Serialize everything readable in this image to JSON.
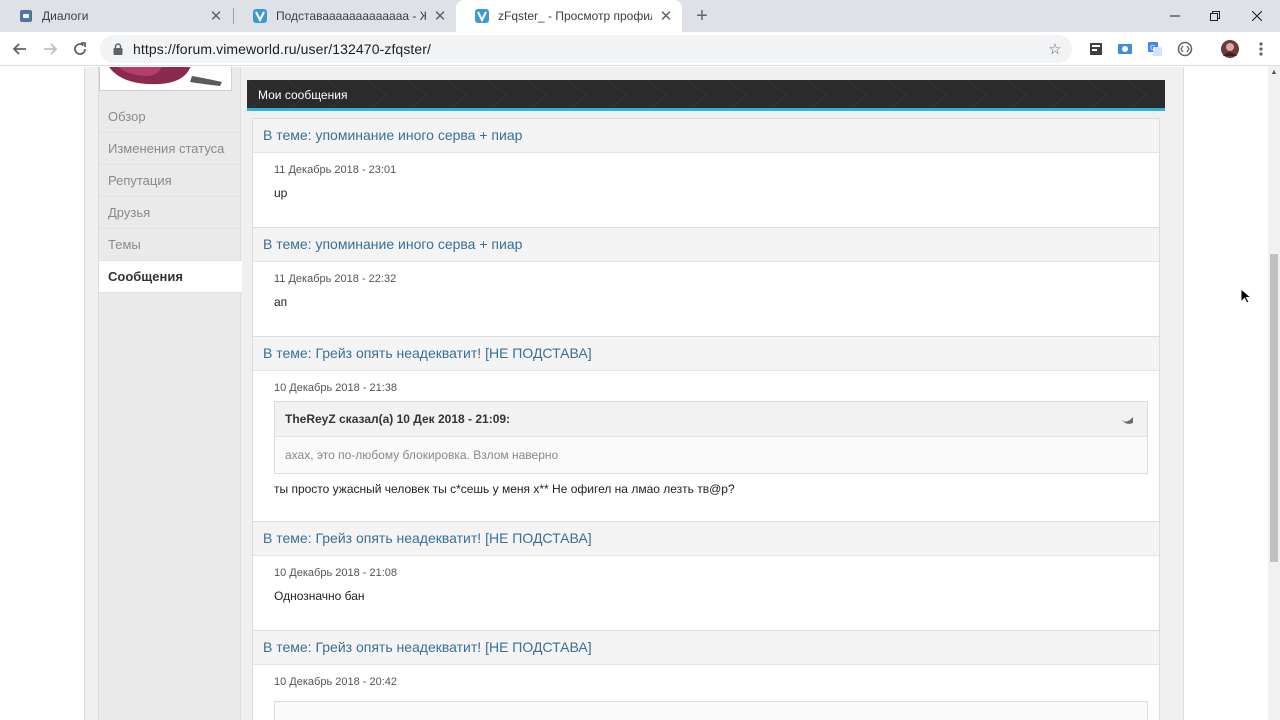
{
  "browser": {
    "tabs": [
      {
        "title": "Диалоги",
        "favicon": "chat-icon",
        "active": false
      },
      {
        "title": "Подставааааааааааааа - Жалобы",
        "favicon": "vimeworld-icon",
        "active": false
      },
      {
        "title": "zFqster_ - Просмотр профиля - ",
        "favicon": "vimeworld-icon",
        "active": true
      }
    ],
    "url": "https://forum.vimeworld.ru/user/132470-zfqster/"
  },
  "sidebar": {
    "items": [
      {
        "label": "Обзор",
        "active": false
      },
      {
        "label": "Изменения статуса",
        "active": false
      },
      {
        "label": "Репутация",
        "active": false
      },
      {
        "label": "Друзья",
        "active": false
      },
      {
        "label": "Темы",
        "active": false
      },
      {
        "label": "Сообщения",
        "active": true
      }
    ]
  },
  "panel": {
    "title": "Мои сообщения"
  },
  "posts": [
    {
      "title": "В теме: упоминание иного серва + пиар",
      "date": "11 Декабрь 2018 - 23:01",
      "text": "up"
    },
    {
      "title": "В теме: упоминание иного серва + пиар",
      "date": "11 Декабрь 2018 - 22:32",
      "text": "ап"
    },
    {
      "title": "В теме: Грейз опять неадекватит! [НЕ ПОДСТАВА]",
      "date": "10 Декабрь 2018 - 21:38",
      "quote": {
        "head": "TheReyZ сказал(а) 10 Дек 2018 - 21:09:",
        "text": "ахах, это по-любому блокировка. Взлом наверно"
      },
      "text": "ты просто ужасный человек ты с*сешь у меня х**  Не офигел на лмао лезть тв@р?"
    },
    {
      "title": "В теме: Грейз опять неадекватит! [НЕ ПОДСТАВА]",
      "date": "10 Декабрь 2018 - 21:08",
      "text": "Однозначно бан"
    },
    {
      "title": "В теме: Грейз опять неадекватит! [НЕ ПОДСТАВА]",
      "date": "10 Декабрь 2018 - 20:42",
      "text": ""
    }
  ],
  "colors": {
    "accent": "#2bb3d9",
    "link": "#3a6f99",
    "header": "#2b2b2b"
  }
}
